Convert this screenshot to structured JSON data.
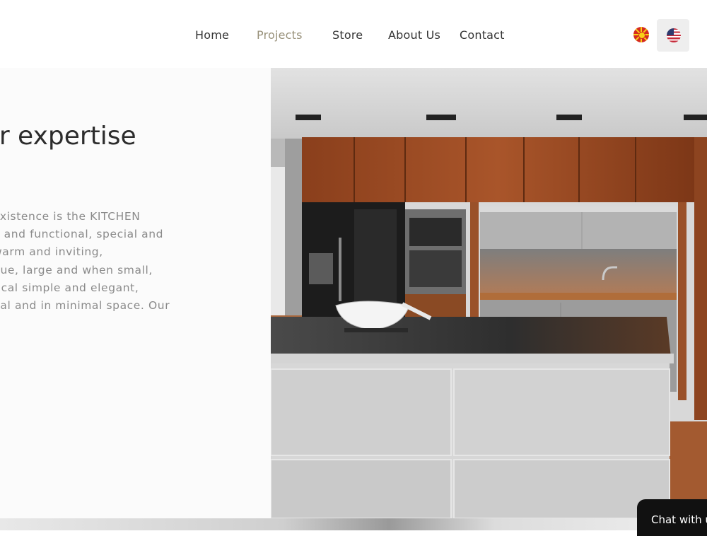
{
  "nav": {
    "items": [
      {
        "label": "Home"
      },
      {
        "label": "Projects",
        "active": true
      },
      {
        "label": "Store"
      },
      {
        "label": "About Us"
      },
      {
        "label": "Contact"
      }
    ],
    "accent_color": "#98917a",
    "languages": [
      {
        "icon": "macedonia-flag-icon"
      },
      {
        "icon": "us-flag-icon",
        "selected": true
      }
    ]
  },
  "intro": {
    "heading": "ur expertise",
    "lines": [
      " existence is the KITCHEN",
      "e and functional, special and",
      "warm and inviting,",
      "que, large and when small,",
      "tical simple and elegant,",
      "nal and in minimal space. Our"
    ]
  },
  "chat": {
    "label": "Chat with u"
  }
}
